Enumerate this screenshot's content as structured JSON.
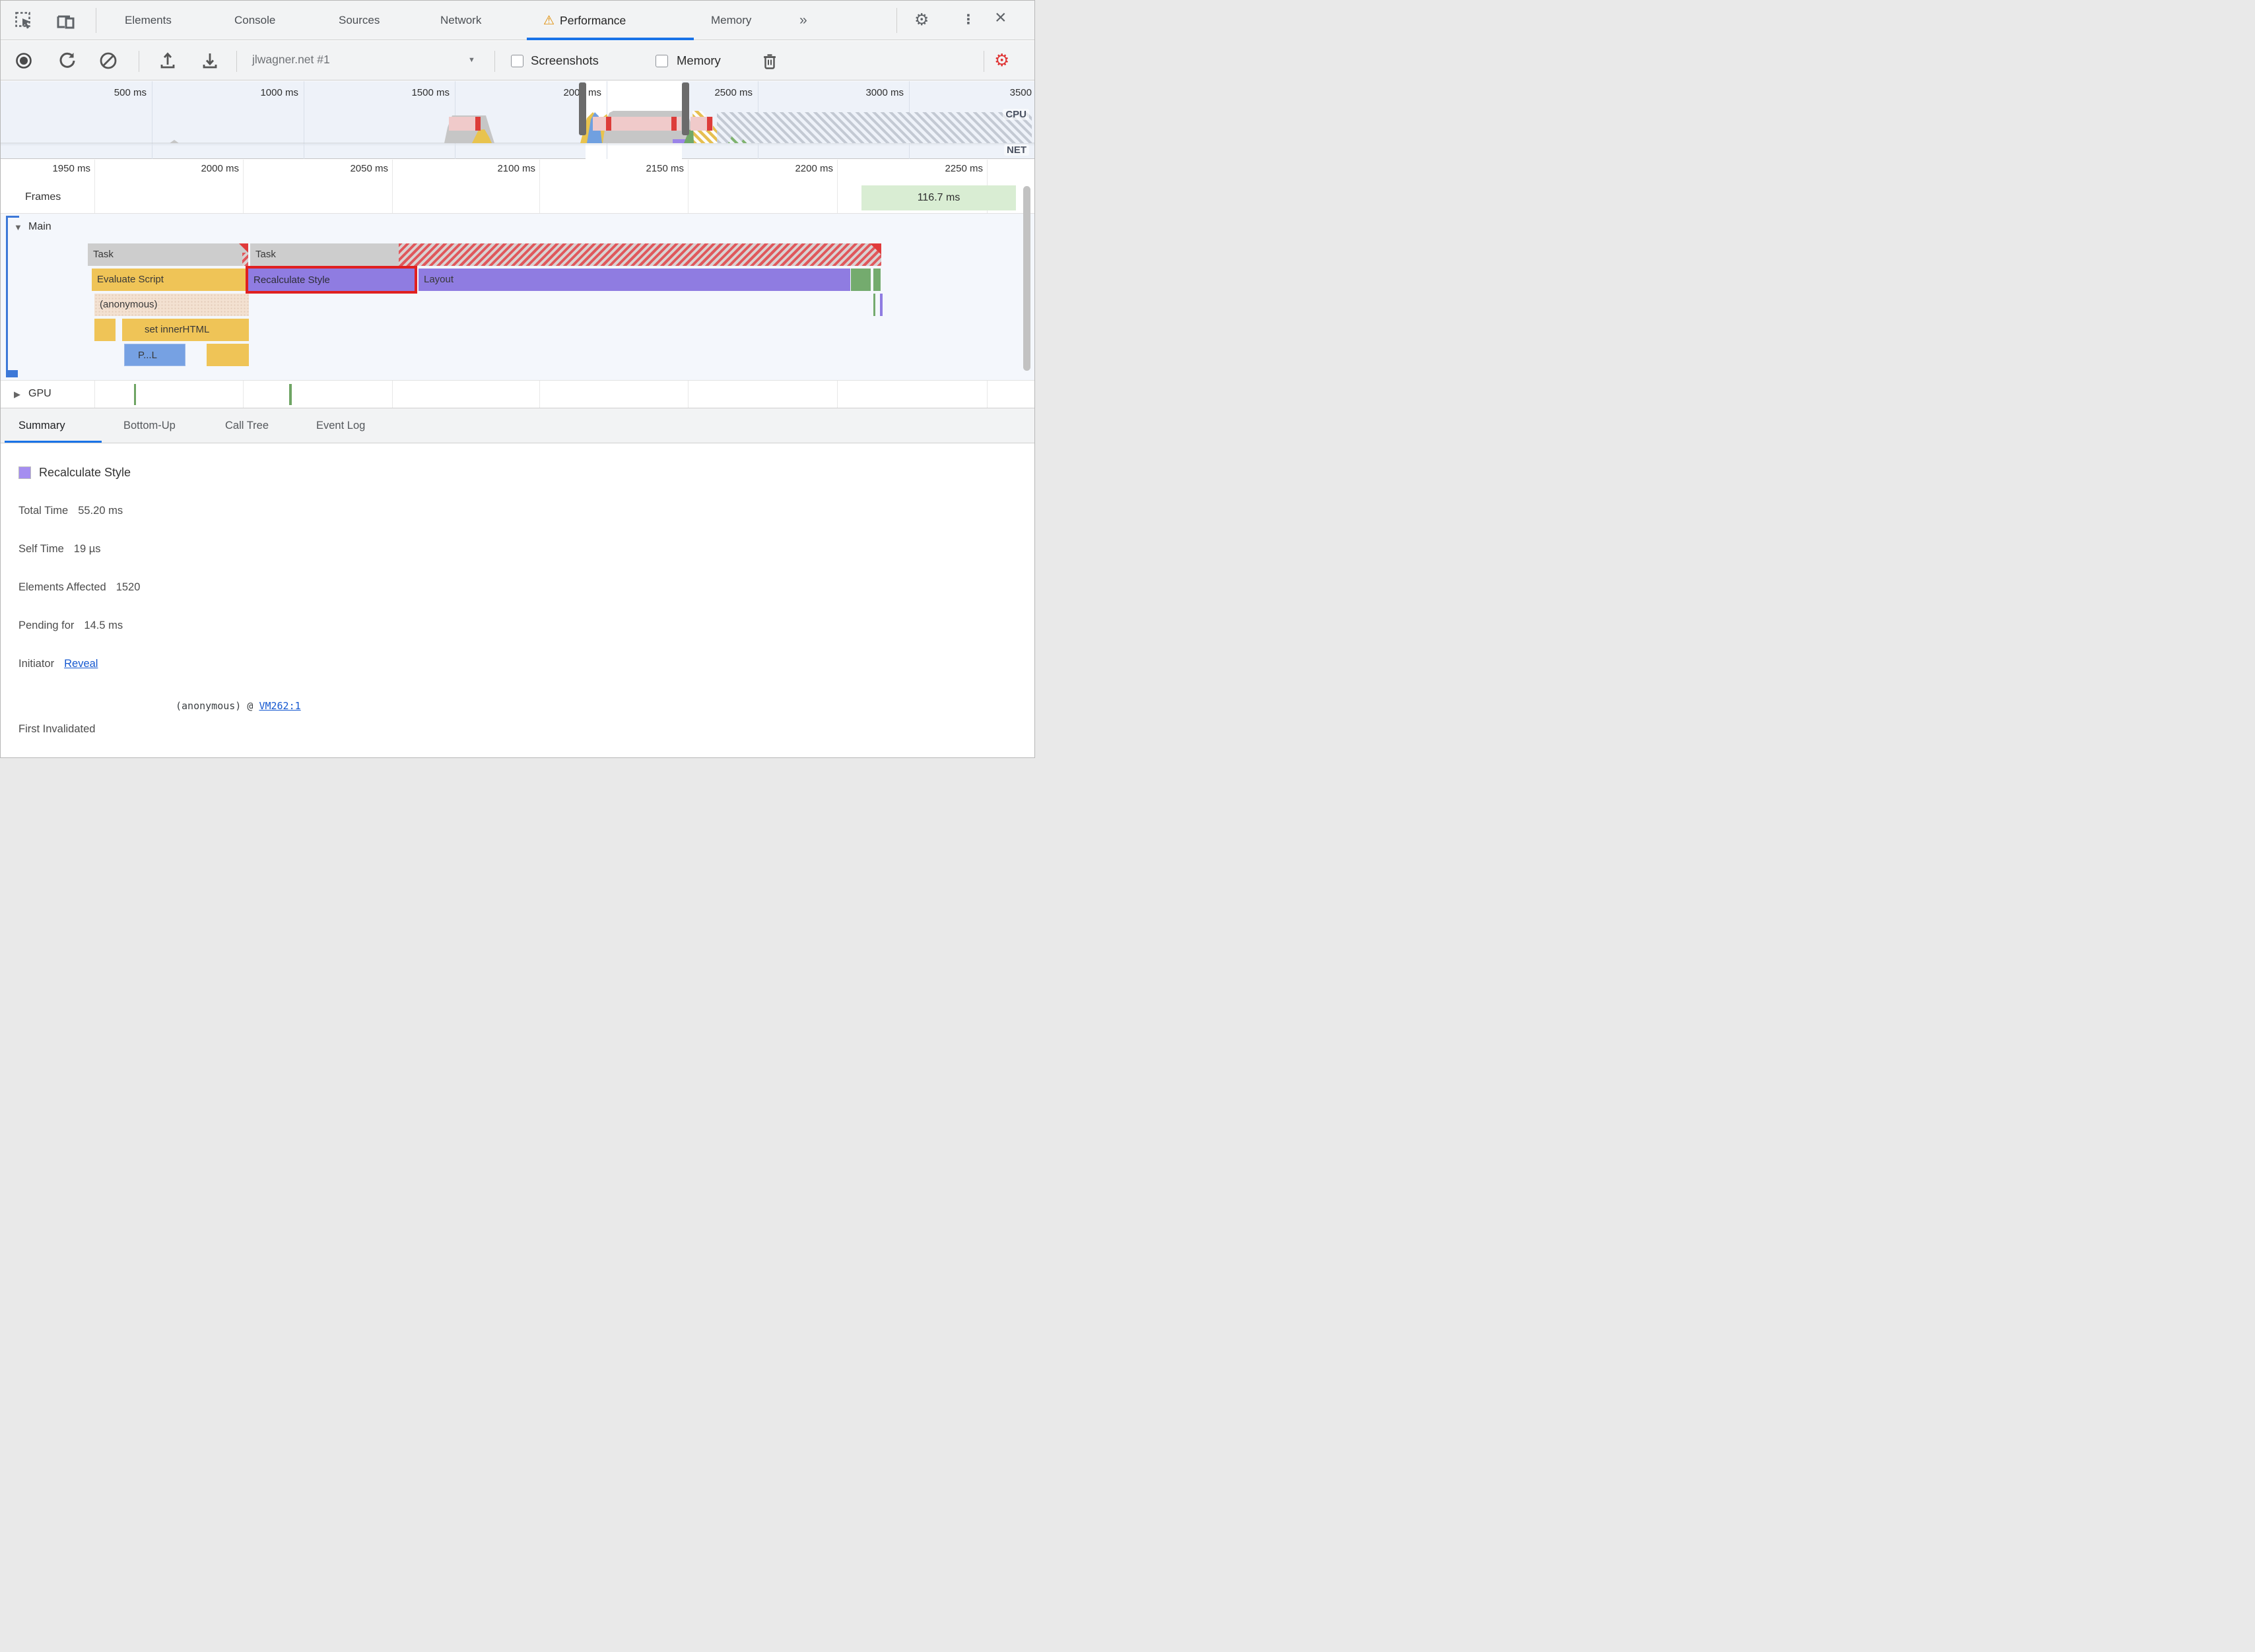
{
  "tabbar": {
    "tabs": [
      {
        "label": "Elements"
      },
      {
        "label": "Console"
      },
      {
        "label": "Sources"
      },
      {
        "label": "Network"
      },
      {
        "label": "Performance",
        "active": true,
        "warning": true
      },
      {
        "label": "Memory"
      }
    ],
    "more_tabs": "»",
    "warning_icon": "⚠",
    "gear_icon": "⚙",
    "kebab_icon": "⋮",
    "close_icon": "×"
  },
  "toolbar": {
    "profile_name": "jlwagner.net #1",
    "dropdown_caret": "▼",
    "screenshots_label": "Screenshots",
    "memory_label": "Memory",
    "capture_settings_icon": "⚙"
  },
  "overview": {
    "tick_labels": [
      "500 ms",
      "1000 ms",
      "1500 ms",
      "2000 ms",
      "2500 ms",
      "3000 ms",
      "3500"
    ],
    "cpu_label": "CPU",
    "net_label": "NET"
  },
  "flame": {
    "ruler_labels": [
      "1950 ms",
      "2000 ms",
      "2050 ms",
      "2100 ms",
      "2150 ms",
      "2200 ms",
      "2250 ms"
    ],
    "frames_label": "Frames",
    "frame_badge": "116.7 ms",
    "main_label": "Main",
    "gpu_label": "GPU",
    "expand_open": "▼",
    "expand_closed": "▶",
    "bars": {
      "task1": "Task",
      "task2": "Task",
      "evaluate_script": "Evaluate Script",
      "recalculate_style": "Recalculate Style",
      "layout": "Layout",
      "anonymous": "(anonymous)",
      "set_inner_html": "set innerHTML",
      "parse_html": "P...L"
    }
  },
  "bottom_tabs": [
    {
      "label": "Summary",
      "active": true
    },
    {
      "label": "Bottom-Up"
    },
    {
      "label": "Call Tree"
    },
    {
      "label": "Event Log"
    }
  ],
  "summary": {
    "title": "Recalculate Style",
    "stats": [
      {
        "label": "Total Time",
        "value": "55.20 ms"
      },
      {
        "label": "Self Time",
        "value": "19 µs"
      },
      {
        "label": "Elements Affected",
        "value": "1520"
      },
      {
        "label": "Pending for",
        "value": "14.5 ms"
      }
    ],
    "initiator_label": "Initiator",
    "initiator_link": "Reveal",
    "first_invalidated_label": "First Invalidated",
    "first_invalidated_prefix": "(anonymous) @ ",
    "first_invalidated_link": "VM262:1"
  },
  "colors": {
    "accent_blue": "#1a73e8",
    "scripting_yellow": "#efc457",
    "style_purple": "#8f7ce1",
    "task_gray": "#cdcdcd",
    "rendering_green": "#74ab6e",
    "parse_blue": "#76a1e3",
    "selection_red": "#e02020",
    "warning_orange": "#e08b00",
    "capture_settings_red": "#df3434",
    "frame_green": "#d9edd3",
    "long_task_pink": "#f0caca"
  }
}
